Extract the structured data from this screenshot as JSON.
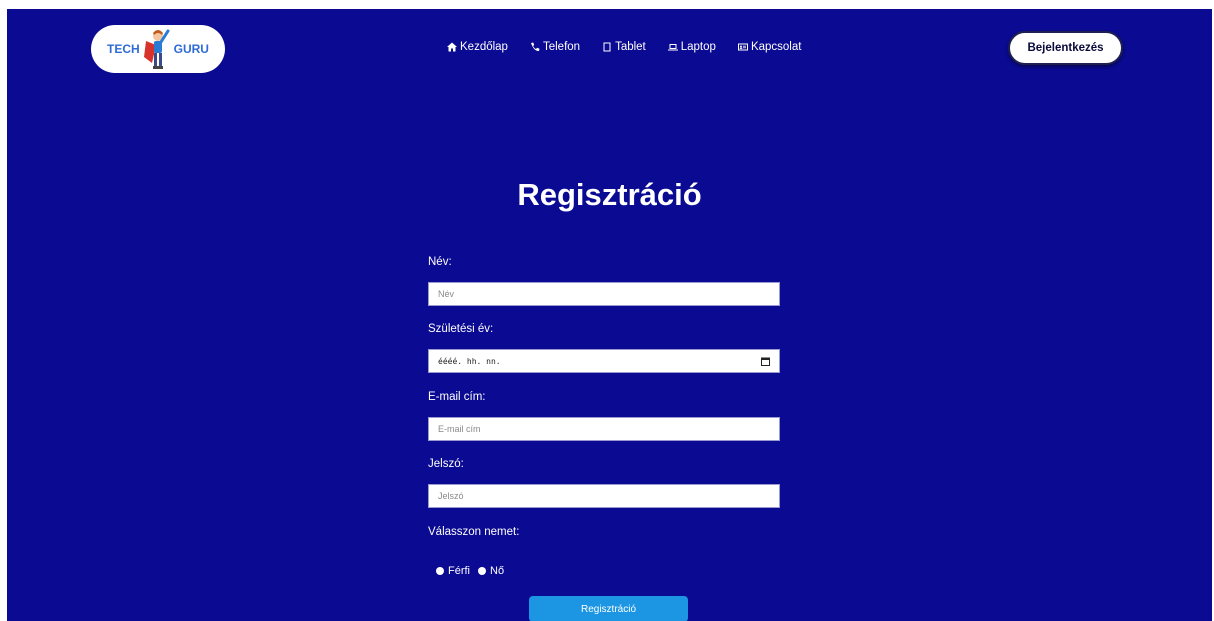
{
  "logo": {
    "left_text": "TECH",
    "right_text": "GURU",
    "icon": "superhero-mascot-icon"
  },
  "nav": [
    {
      "label": "Kezdőlap",
      "icon": "home-icon"
    },
    {
      "label": "Telefon",
      "icon": "phone-icon"
    },
    {
      "label": "Tablet",
      "icon": "tablet-icon"
    },
    {
      "label": "Laptop",
      "icon": "laptop-icon"
    },
    {
      "label": "Kapcsolat",
      "icon": "contact-card-icon"
    }
  ],
  "header": {
    "login_label": "Bejelentkezés"
  },
  "page": {
    "title": "Regisztráció"
  },
  "form": {
    "name_label": "Név:",
    "name_placeholder": "Név",
    "birth_label": "Születési év:",
    "birth_placeholder": "éééé. hh. nn.",
    "email_label": "E-mail cím:",
    "email_placeholder": "E-mail cím",
    "password_label": "Jelszó:",
    "password_placeholder": "Jelszó",
    "gender_label": "Válasszon nemet:",
    "gender_options": [
      "Férfi",
      "Nő"
    ],
    "submit_label": "Regisztráció"
  },
  "colors": {
    "background": "#0a0a92",
    "submit": "#1c96e3",
    "logo_text": "#2f6bd6"
  }
}
